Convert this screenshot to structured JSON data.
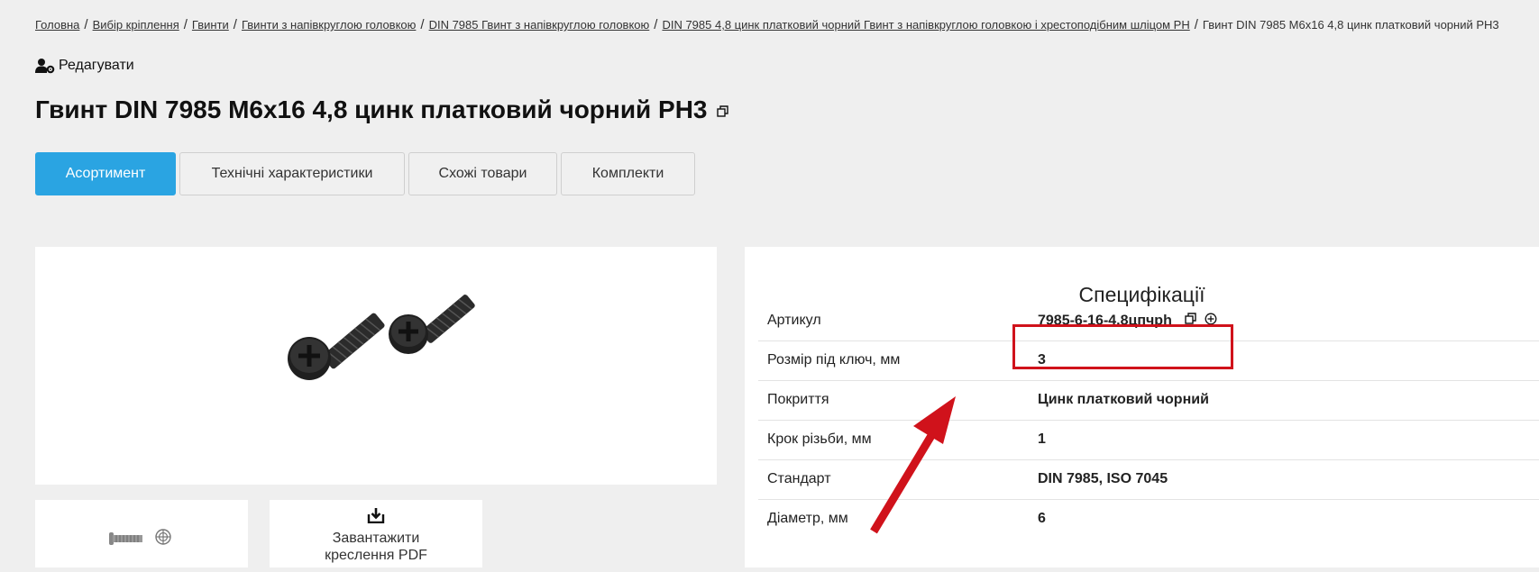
{
  "breadcrumb": {
    "items": [
      "Головна",
      "Вибір кріплення",
      "Гвинти",
      "Гвинти з напівкруглою головкою",
      "DIN 7985 Гвинт з напівкруглою головкою",
      "DIN 7985 4,8 цинк платковий чорний Гвинт з напівкруглою головкою і хрестоподібним шліцом PH"
    ],
    "separator": "/",
    "current": "Гвинт DIN 7985 M6x16 4,8 цинк платковий чорний PH3"
  },
  "edit": {
    "label": "Редагувати"
  },
  "title": "Гвинт DIN 7985 M6x16 4,8 цинк платковий чорний PH3",
  "tabs": [
    {
      "label": "Асортимент",
      "active": true
    },
    {
      "label": "Технічні характеристики",
      "active": false
    },
    {
      "label": "Схожі товари",
      "active": false
    },
    {
      "label": "Комплекти",
      "active": false
    }
  ],
  "thumb2": {
    "line1": "Завантажити",
    "line2": "креслення PDF"
  },
  "spec": {
    "title": "Специфікації",
    "rows": [
      {
        "label": "Артикул",
        "value": "7985-6-16-4,8цпчрh"
      },
      {
        "label": "Розмір під ключ, мм",
        "value": "3"
      },
      {
        "label": "Покриття",
        "value": "Цинк платковий чорний"
      },
      {
        "label": "Крок різьби, мм",
        "value": "1"
      },
      {
        "label": "Стандарт",
        "value": "DIN 7985, ISO 7045"
      },
      {
        "label": "Діаметр, мм",
        "value": "6"
      }
    ]
  },
  "colors": {
    "accent": "#2aa4e2",
    "highlight": "#d0121b",
    "background": "#efefef"
  },
  "icons": [
    "user-gear-icon",
    "copy-icon",
    "add-circle-icon",
    "download-icon",
    "screw-thumbnail-icon"
  ]
}
